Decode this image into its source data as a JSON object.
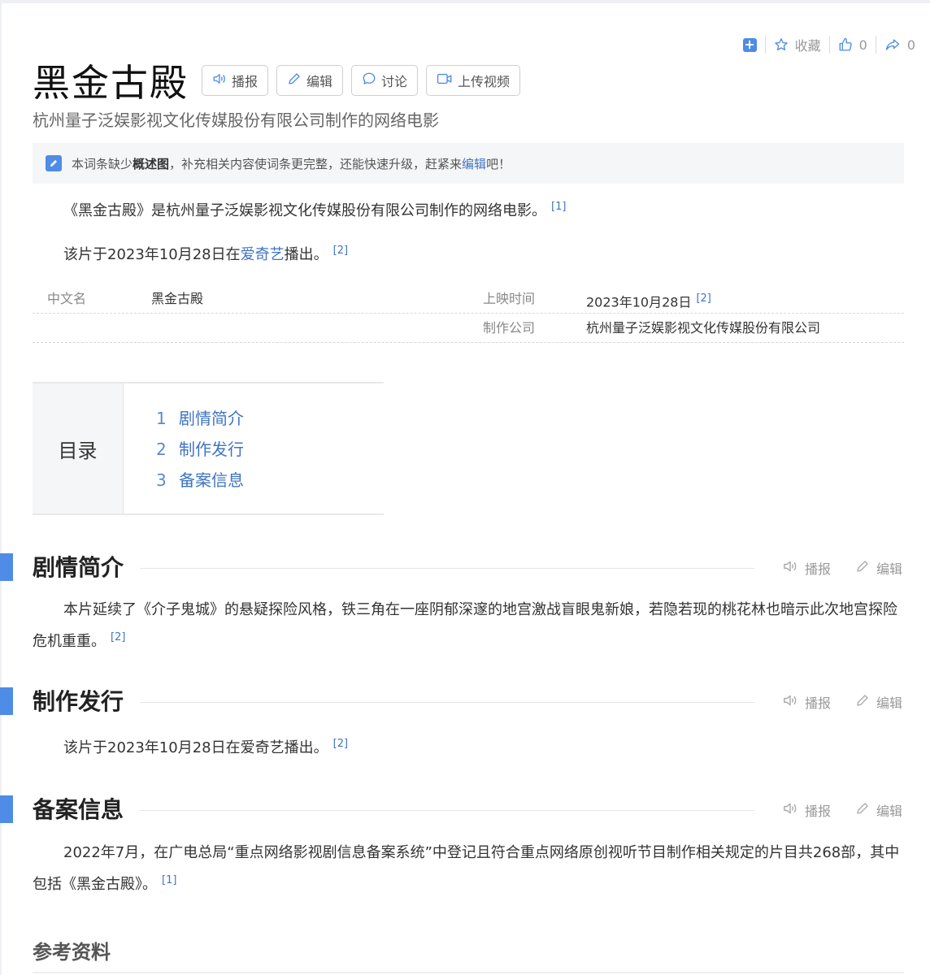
{
  "top_actions": {
    "favorite_label": "收藏",
    "like_count": "0",
    "share_count": "0"
  },
  "header": {
    "title": "黑金古殿",
    "buttons": {
      "broadcast": "播报",
      "edit": "编辑",
      "discuss": "讨论",
      "upload_video": "上传视频"
    },
    "subtitle": "杭州量子泛娱影视文化传媒股份有限公司制作的网络电影"
  },
  "notice": {
    "prefix": "本词条缺少",
    "bold": "概述图",
    "middle": "，补充相关内容使词条更完整，还能快速升级，赶紧来",
    "link": "编辑",
    "suffix": "吧！"
  },
  "summary": {
    "para1": "《黑金古殿》是杭州量子泛娱影视文化传媒股份有限公司制作的网络电影。",
    "para1_ref": "[1]",
    "para2_prefix": "该片于2023年10月28日在",
    "para2_link": "爱奇艺",
    "para2_suffix": "播出。",
    "para2_ref": "[2]"
  },
  "info": {
    "chinese_name_key": "中文名",
    "chinese_name_val": "黑金古殿",
    "release_key": "上映时间",
    "release_val": "2023年10月28日",
    "release_ref": "[2]",
    "company_key": "制作公司",
    "company_val": "杭州量子泛娱影视文化传媒股份有限公司"
  },
  "toc": {
    "label": "目录",
    "items": [
      {
        "num": "1",
        "text": "剧情简介"
      },
      {
        "num": "2",
        "text": "制作发行"
      },
      {
        "num": "3",
        "text": "备案信息"
      }
    ]
  },
  "section_tools": {
    "broadcast": "播报",
    "edit": "编辑"
  },
  "sections": {
    "plot": {
      "title": "剧情简介",
      "text": "本片延续了《介子鬼城》的悬疑探险风格，铁三角在一座阴郁深邃的地宫激战盲眼鬼新娘，若隐若现的桃花林也暗示此次地宫探险危机重重。",
      "ref": "[2]"
    },
    "production": {
      "title": "制作发行",
      "text": "该片于2023年10月28日在爱奇艺播出。",
      "ref": "[2]"
    },
    "filing": {
      "title": "备案信息",
      "text": "2022年7月，在广电总局“重点网络影视剧信息备案系统”中登记且符合重点网络原创视听节目制作相关规定的片目共268部，其中包括《黑金古殿》。",
      "ref": "[1]"
    }
  },
  "references_title": "参考资料",
  "colors": {
    "accent": "#4e8ce6",
    "link": "#3f74c2"
  }
}
